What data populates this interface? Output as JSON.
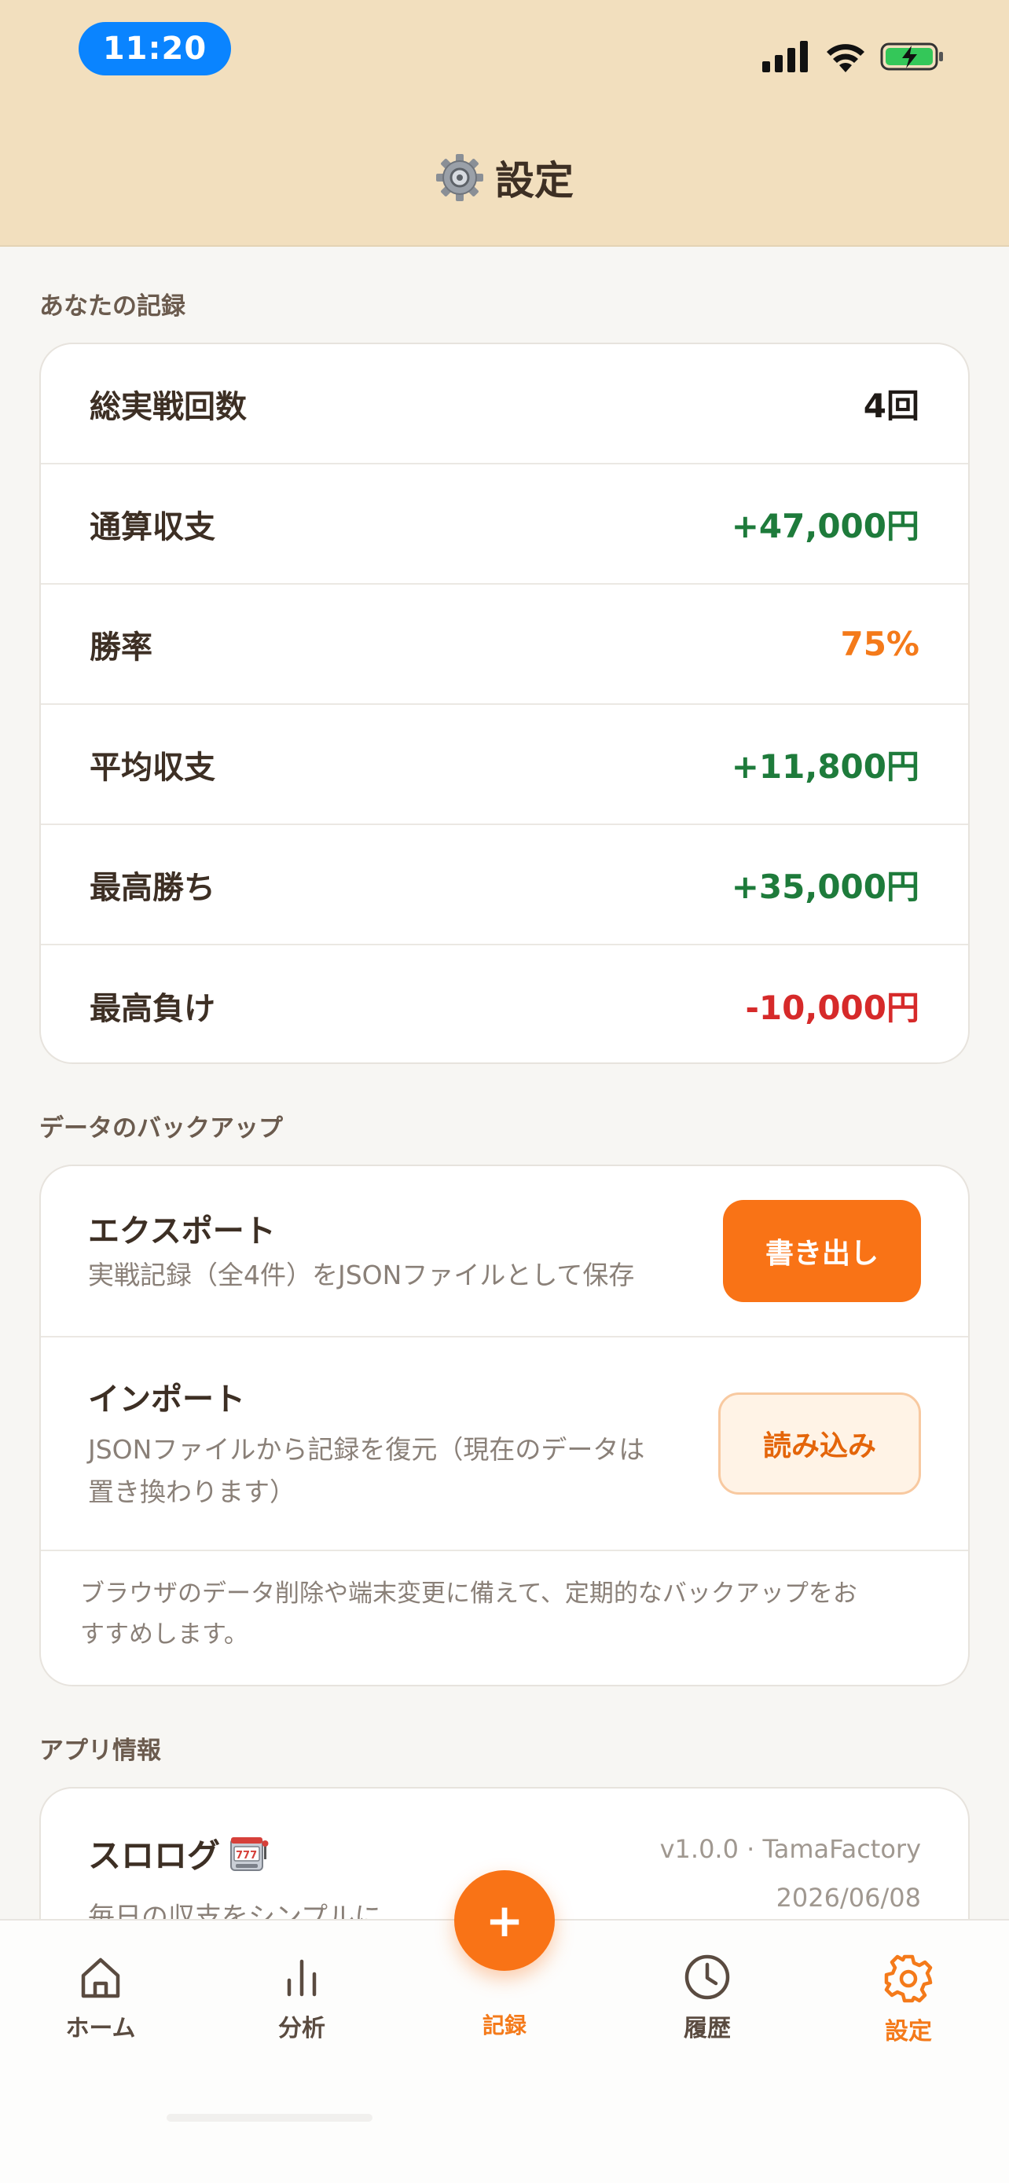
{
  "status_bar": {
    "time": "11:20"
  },
  "header": {
    "title": "設定",
    "icon": "gear-icon"
  },
  "records": {
    "section_label": "あなたの記録",
    "rows": [
      {
        "label": "総実戦回数",
        "value": "4回",
        "color": "#1f1a16"
      },
      {
        "label": "通算収支",
        "value": "+47,000円",
        "color": "#1E7B3B"
      },
      {
        "label": "勝率",
        "value": "75%",
        "color": "#F47A1A"
      },
      {
        "label": "平均収支",
        "value": "+11,800円",
        "color": "#1E7B3B"
      },
      {
        "label": "最高勝ち",
        "value": "+35,000円",
        "color": "#1E7B3B"
      },
      {
        "label": "最高負け",
        "value": "-10,000円",
        "color": "#D62A2A"
      }
    ]
  },
  "backup": {
    "section_label": "データのバックアップ",
    "export": {
      "title": "エクスポート",
      "description": "実戦記録（全4件）をJSONファイルとして保存",
      "button": "書き出し"
    },
    "import": {
      "title": "インポート",
      "description_line1": "JSONファイルから記録を復元（現在のデータは",
      "description_line2": "置き換わります）",
      "button": "読み込み"
    },
    "note_line1": "ブラウザのデータ削除や端末変更に備えて、定期的なバックアップをお",
    "note_line2": "すすめします。"
  },
  "app_info": {
    "section_label": "アプリ情報",
    "name": "スロログ",
    "icon": "slot-machine-icon",
    "tagline": "毎日の収支をシンプルに",
    "version": "v1.0.0 · TamaFactory",
    "date": "2026/06/08"
  },
  "tab_bar": {
    "home": "ホーム",
    "analysis": "分析",
    "record": "記録",
    "history": "履歴",
    "settings": "設定",
    "fab_symbol": "+",
    "active_color": "#F47A1A"
  }
}
